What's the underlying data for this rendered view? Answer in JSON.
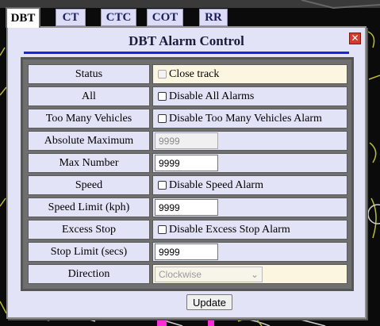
{
  "tabs": [
    {
      "label": "DBT",
      "active": true
    },
    {
      "label": "CT",
      "active": false
    },
    {
      "label": "CTC",
      "active": false
    },
    {
      "label": "COT",
      "active": false
    },
    {
      "label": "RR",
      "active": false
    }
  ],
  "dialog": {
    "title": "DBT Alarm Control",
    "close_icon": "close-icon",
    "update_label": "Update"
  },
  "rows": {
    "status": {
      "label": "Status",
      "checkbox_label": "Close track",
      "enabled": false
    },
    "all": {
      "label": "All",
      "checkbox_label": "Disable All Alarms"
    },
    "too_many": {
      "label": "Too Many Vehicles",
      "checkbox_label": "Disable Too Many Vehicles Alarm"
    },
    "abs_max": {
      "label": "Absolute Maximum",
      "value": "9999",
      "enabled": false
    },
    "max_number": {
      "label": "Max Number",
      "value": "9999"
    },
    "speed": {
      "label": "Speed",
      "checkbox_label": "Disable Speed Alarm"
    },
    "speed_limit": {
      "label": "Speed Limit (kph)",
      "value": "9999"
    },
    "excess_stop": {
      "label": "Excess Stop",
      "checkbox_label": "Disable Excess Stop Alarm"
    },
    "stop_limit": {
      "label": "Stop Limit (secs)",
      "value": "9999"
    },
    "direction": {
      "label": "Direction",
      "selected": "Clockwise",
      "enabled": false
    }
  },
  "colors": {
    "title_rule": "#1a23e0",
    "dialog_bg": "#e3e3f7",
    "highlight_cell": "#fcf6e0",
    "close_button": "#d9382a"
  }
}
